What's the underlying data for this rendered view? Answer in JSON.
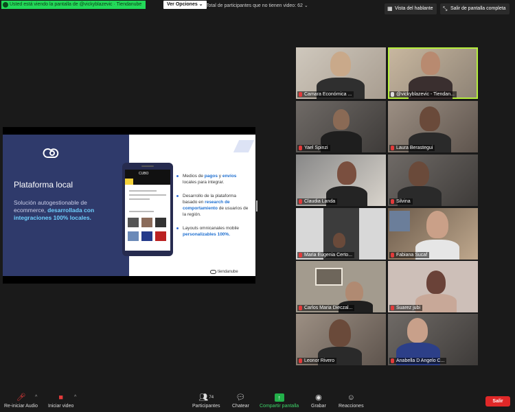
{
  "top": {
    "share_banner": "Usted está viendo la pantalla de @vickyblazevic · Tiendanube",
    "view_options": "Ver Opciones ⌄",
    "no_video_label": "Total de participantes que no tienen video: 62 ⌄",
    "speaker_view": "Vista del hablante",
    "exit_fullscreen": "Salir de pantalla completa"
  },
  "slide": {
    "title": "Plataforma local",
    "desc_plain": "Solución autogestionable de ecommerce,",
    "desc_bold": "desarrollada con integraciones 100% locales.",
    "phone_brand": "CUBO",
    "bullets": [
      {
        "pre": "Medios de ",
        "b1": "pagos",
        "mid": " y ",
        "b2": "envíos",
        "post": " locales para integrar."
      },
      {
        "pre": "Desarrollo de la plataforma basado en ",
        "b1": "research de comportamiento",
        "mid": "",
        "b2": "",
        "post": " de usuarios de la región."
      },
      {
        "pre": "Layouts omnicanales mobile ",
        "b1": "personalizables 100%.",
        "mid": "",
        "b2": "",
        "post": ""
      }
    ],
    "brand": "tiendanube"
  },
  "participants": [
    {
      "name": "Camara Económica ..."
    },
    {
      "name": "@vickyblazevic - Tiendan..."
    },
    {
      "name": "Yael Spinzi"
    },
    {
      "name": "Laura Berastegui"
    },
    {
      "name": "Claudia Landa"
    },
    {
      "name": "Silvina"
    },
    {
      "name": "Maria Eugenia Certo..."
    },
    {
      "name": "Fabiana Sucaf"
    },
    {
      "name": "Carlos Maria Dieczal..."
    },
    {
      "name": "Suarez jubi"
    },
    {
      "name": "Leonor Rivero"
    },
    {
      "name": "Anabella D Angelo C..."
    }
  ],
  "toolbar": {
    "audio": "Re-iniciar Audio",
    "video": "Iniciar video",
    "participants": "Participantes",
    "participants_count": "74",
    "chat": "Chatear",
    "share": "Compartir pantalla",
    "record": "Grabar",
    "reactions": "Reacciones",
    "leave": "Salir"
  },
  "colors": {
    "active_speaker": "#b6f03c",
    "share_green": "#23d959",
    "leave_red": "#e02828",
    "slide_navy": "#2f3a6b"
  }
}
